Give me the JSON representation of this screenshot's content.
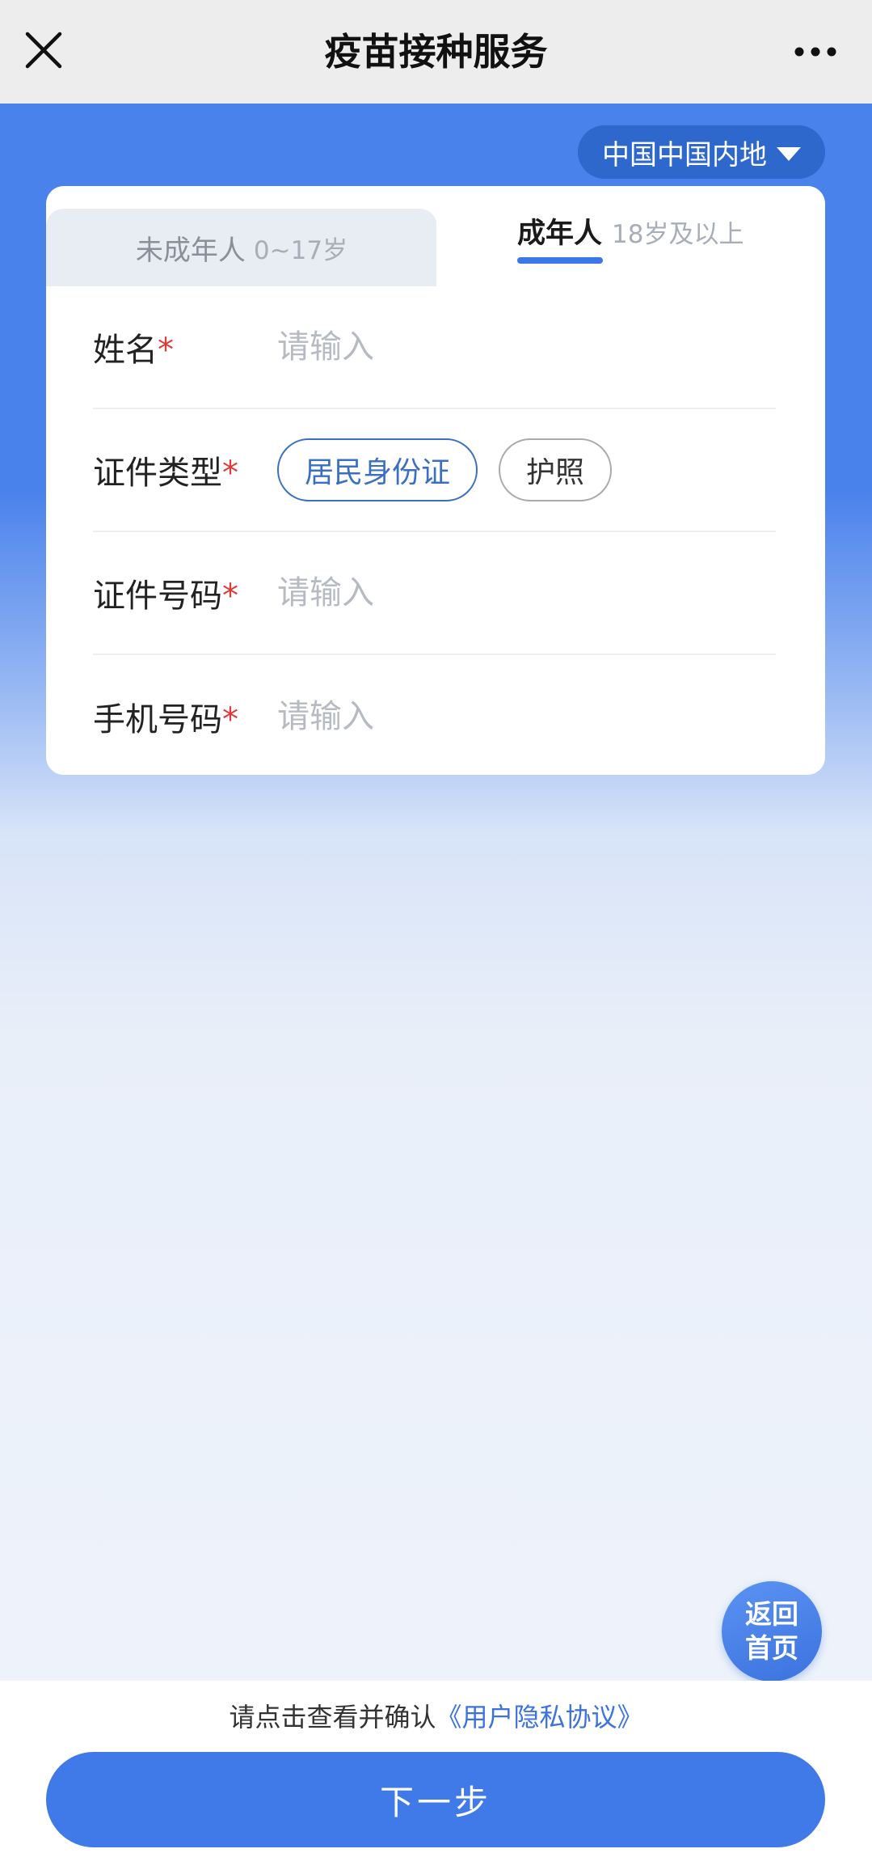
{
  "titlebar": {
    "title": "疫苗接种服务",
    "close_icon": "close-icon",
    "more_icon": "more-icon"
  },
  "region": {
    "label": "中国中国内地",
    "icon": "caret-down-icon"
  },
  "tabs": {
    "minor": {
      "label": "未成年人",
      "age": "0~17岁"
    },
    "adult": {
      "label": "成年人",
      "age": "18岁及以上"
    },
    "active": "adult",
    "accent": "#3b78e7"
  },
  "form": {
    "name": {
      "label": "姓名",
      "required_mark": "*",
      "placeholder": "请输入"
    },
    "id_type": {
      "label": "证件类型",
      "required_mark": "*",
      "options": [
        "居民身份证",
        "护照"
      ],
      "selected": "居民身份证"
    },
    "id_number": {
      "label": "证件号码",
      "required_mark": "*",
      "placeholder": "请输入"
    },
    "phone": {
      "label": "手机号码",
      "required_mark": "*",
      "placeholder": "请输入"
    }
  },
  "home_button": {
    "line1": "返回",
    "line2": "首页"
  },
  "agreement": {
    "prefix": "请点击查看并确认",
    "link": "《用户隐私协议》"
  },
  "next_button": {
    "label": "下一步"
  },
  "colors": {
    "brand_blue": "#3f7ae8",
    "required_red": "#e03a3a",
    "titlebar_bg": "#ededed"
  }
}
